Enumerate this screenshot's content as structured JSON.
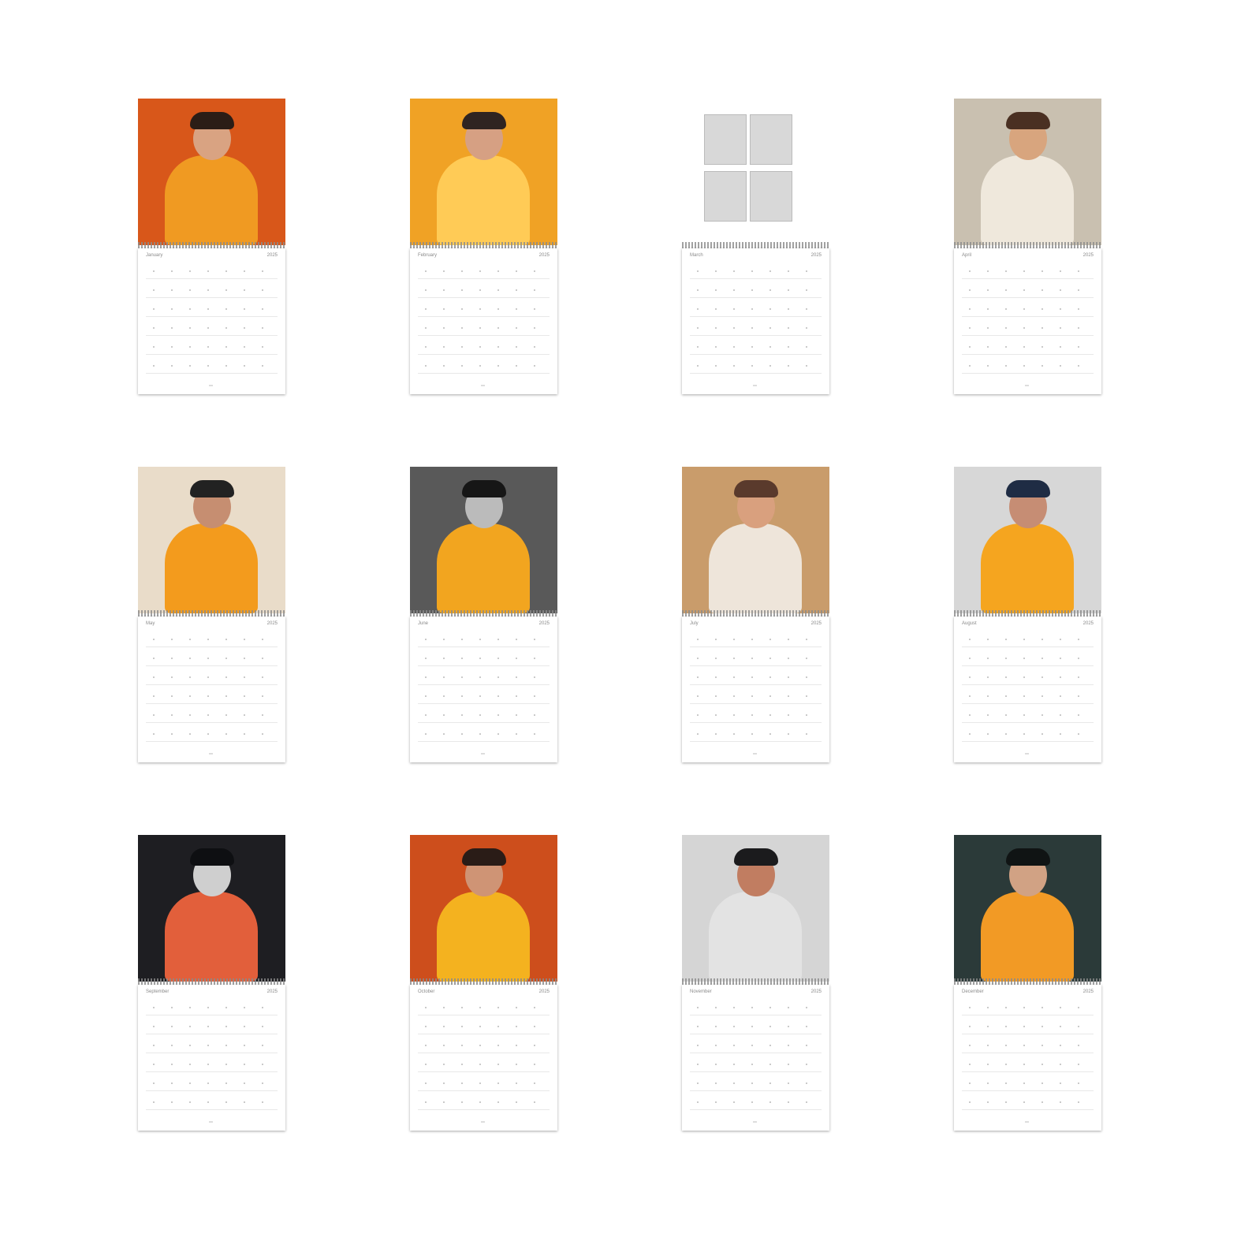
{
  "year": "2025",
  "calendars": [
    {
      "month": "January",
      "photo": {
        "background": "#d8571a",
        "accent": "#f09a22",
        "dark": "#2b1d16",
        "skin": "#d9a382"
      }
    },
    {
      "month": "February",
      "photo": {
        "background": "#f0a225",
        "accent": "#ffcb56",
        "dark": "#2f2421",
        "skin": "#d6a083"
      }
    },
    {
      "month": "March",
      "photo": {
        "background": "#f4f4f4",
        "accent": "#6f9f47",
        "dark": "#3a3a3a",
        "skin": "#c9b8a9"
      }
    },
    {
      "month": "April",
      "photo": {
        "background": "#c9c0b0",
        "accent": "#efe8dc",
        "dark": "#4a3022",
        "skin": "#d8a57e"
      }
    },
    {
      "month": "May",
      "photo": {
        "background": "#e9dcc9",
        "accent": "#f39b1d",
        "dark": "#222222",
        "skin": "#c68e71"
      }
    },
    {
      "month": "June",
      "photo": {
        "background": "#595959",
        "accent": "#f2a51f",
        "dark": "#161616",
        "skin": "#bbbbbb"
      }
    },
    {
      "month": "July",
      "photo": {
        "background": "#c99c6b",
        "accent": "#eee5da",
        "dark": "#5a3a2c",
        "skin": "#d9a07e"
      }
    },
    {
      "month": "August",
      "photo": {
        "background": "#d7d7d7",
        "accent": "#f5a51f",
        "dark": "#1f2c44",
        "skin": "#c68d74"
      }
    },
    {
      "month": "September",
      "photo": {
        "background": "#1e1e22",
        "accent": "#e25f3b",
        "dark": "#0e0f12",
        "skin": "#cfcfcf"
      }
    },
    {
      "month": "October",
      "photo": {
        "background": "#cd4e1c",
        "accent": "#f4b21f",
        "dark": "#2a1c17",
        "skin": "#cf9475"
      }
    },
    {
      "month": "November",
      "photo": {
        "background": "#d5d5d5",
        "accent": "#e3e3e3",
        "dark": "#1b1b1d",
        "skin": "#c17d61"
      }
    },
    {
      "month": "December",
      "photo": {
        "background": "#2b3a39",
        "accent": "#f29a25",
        "dark": "#101414",
        "skin": "#d1a284"
      }
    }
  ]
}
